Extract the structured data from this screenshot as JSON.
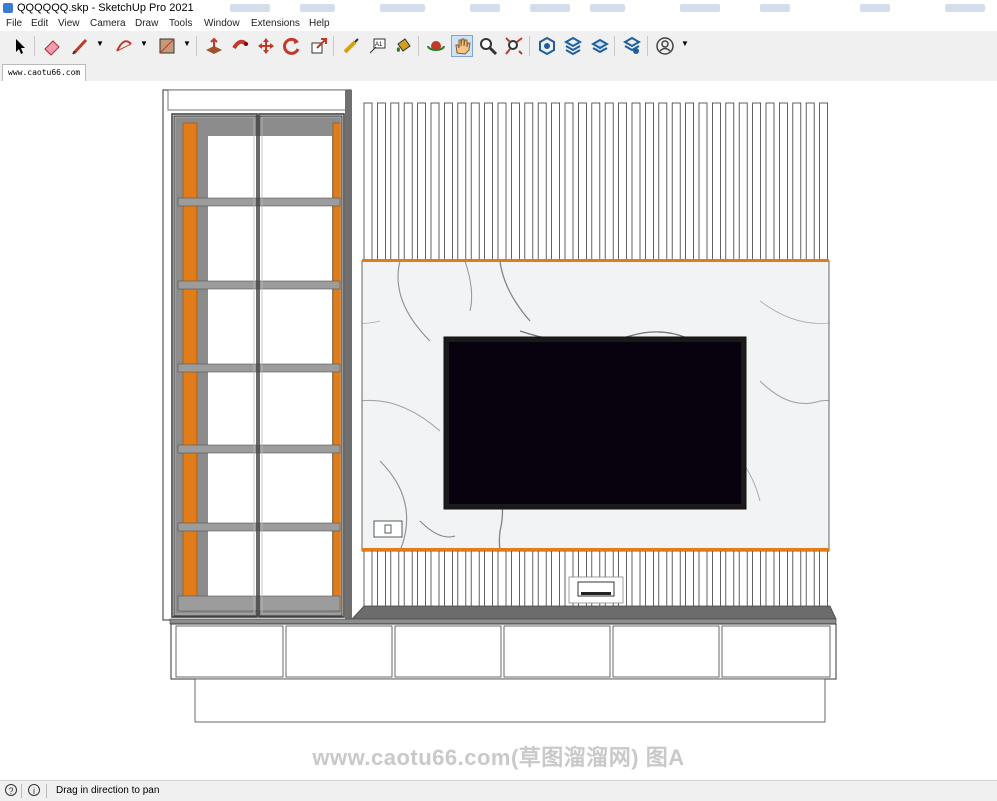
{
  "window": {
    "title": "QQQQQQ.skp - SketchUp Pro 2021"
  },
  "menu": [
    "File",
    "Edit",
    "View",
    "Camera",
    "Draw",
    "Tools",
    "Window",
    "Extensions",
    "Help"
  ],
  "toolbar": {
    "tools": [
      {
        "name": "select-tool-icon"
      },
      {
        "name": "eraser-tool-icon"
      },
      {
        "name": "line-tool-icon"
      },
      {
        "name": "arc-tool-icon"
      },
      {
        "name": "rectangle-tool-icon"
      },
      {
        "name": "push-pull-tool-icon"
      },
      {
        "name": "follow-me-tool-icon"
      },
      {
        "name": "move-tool-icon"
      },
      {
        "name": "rotate-tool-icon"
      },
      {
        "name": "scale-tool-icon"
      },
      {
        "name": "tape-measure-tool-icon"
      },
      {
        "name": "text-tool-icon",
        "label": "A1"
      },
      {
        "name": "paint-bucket-tool-icon"
      },
      {
        "name": "orbit-tool-icon"
      },
      {
        "name": "pan-tool-icon",
        "active": true
      },
      {
        "name": "zoom-tool-icon"
      },
      {
        "name": "zoom-extents-tool-icon"
      },
      {
        "name": "3d-warehouse-icon"
      },
      {
        "name": "extension-warehouse-icon"
      },
      {
        "name": "layout-icon"
      },
      {
        "name": "extension-manager-icon"
      },
      {
        "name": "account-icon"
      }
    ]
  },
  "tab": {
    "label": "www.caotu66.com"
  },
  "viewport": {
    "watermark": "www.caotu66.com(草图溜溜网) 图A",
    "colors": {
      "wood": "#e07d1a",
      "shelf": "#8a8a8a",
      "tv": "#08020f",
      "marble": "#eef0f1"
    }
  },
  "status": {
    "text": "Drag in direction to pan"
  }
}
